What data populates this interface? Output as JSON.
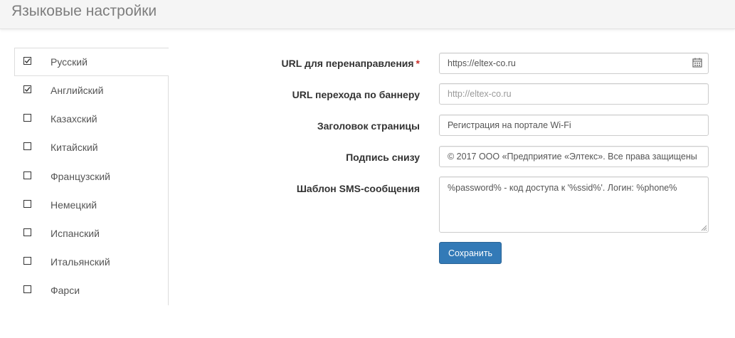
{
  "header": {
    "title": "Языковые настройки"
  },
  "languages": [
    {
      "label": "Русский",
      "checked": true,
      "active": true
    },
    {
      "label": "Английский",
      "checked": true,
      "active": false
    },
    {
      "label": "Казахский",
      "checked": false,
      "active": false
    },
    {
      "label": "Китайский",
      "checked": false,
      "active": false
    },
    {
      "label": "Французский",
      "checked": false,
      "active": false
    },
    {
      "label": "Немецкий",
      "checked": false,
      "active": false
    },
    {
      "label": "Испанский",
      "checked": false,
      "active": false
    },
    {
      "label": "Итальянский",
      "checked": false,
      "active": false
    },
    {
      "label": "Фарси",
      "checked": false,
      "active": false
    }
  ],
  "form": {
    "redirect_url": {
      "label": "URL для перенаправления",
      "required_mark": "*",
      "value": "https://eltex-co.ru",
      "icon": "calendar-icon"
    },
    "banner_url": {
      "label": "URL перехода по баннеру",
      "value": "",
      "placeholder": "http://eltex-co.ru"
    },
    "page_title": {
      "label": "Заголовок страницы",
      "value": "Регистрация на портале Wi-Fi"
    },
    "footer": {
      "label": "Подпись снизу",
      "value": "© 2017 ООО «Предприятие «Элтекс». Все права защищены"
    },
    "sms_template": {
      "label": "Шаблон SMS-сообщения",
      "value": "%password% - код доступа к '%ssid%'. Логин: %phone%"
    },
    "save_label": "Сохранить"
  },
  "colors": {
    "primary": "#337ab7",
    "required": "#c9302c",
    "header_bg": "#f5f5f5"
  }
}
